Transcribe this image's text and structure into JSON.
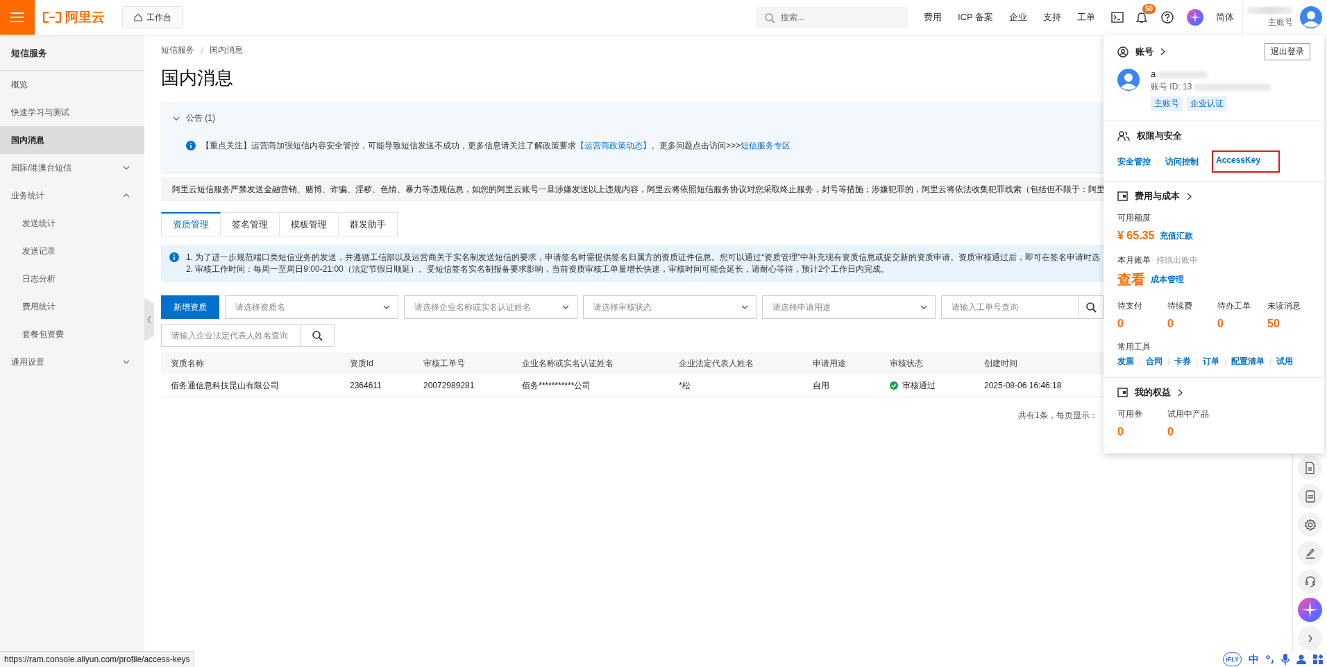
{
  "topbar": {
    "logo": "阿里云",
    "workbench": "工作台",
    "search_placeholder": "搜索...",
    "nav": [
      "费用",
      "ICP 备案",
      "企业",
      "支持",
      "工单"
    ],
    "notification_count": "50",
    "language": "简体",
    "account_role": "主账号"
  },
  "sidebar": {
    "title": "短信服务",
    "items": [
      {
        "kind": "link",
        "label": "概览",
        "selected": false
      },
      {
        "kind": "link",
        "label": "快速学习与测试",
        "selected": false
      },
      {
        "kind": "link",
        "label": "国内消息",
        "selected": true
      },
      {
        "kind": "group",
        "label": "国际/港澳台短信",
        "selected": false,
        "expanded": false
      },
      {
        "kind": "group",
        "label": "业务统计",
        "selected": false,
        "expanded": true,
        "children": [
          {
            "label": "发送统计",
            "selected": false
          },
          {
            "label": "发送记录",
            "selected": false
          },
          {
            "label": "日志分析",
            "selected": false
          },
          {
            "label": "费用统计",
            "selected": false
          },
          {
            "label": "套餐包资费",
            "selected": false
          }
        ]
      },
      {
        "kind": "group",
        "label": "通用设置",
        "selected": false,
        "expanded": false
      }
    ]
  },
  "breadcrumb": [
    "短信服务",
    "国内消息"
  ],
  "page_title": "国内消息",
  "announcement": {
    "title": "公告 (1)",
    "expanded": true,
    "parts": [
      {
        "text": "【重点关注】运营商加强短信内容安全管控，可能导致短信发送不成功，更多信息请关注了解政策要求",
        "link": false
      },
      {
        "text": "【运营商政策动态】",
        "link": true
      },
      {
        "text": "。更多问题点击访问>>>",
        "link": false
      },
      {
        "text": "短信服务专区",
        "link": true
      }
    ]
  },
  "warning": "阿里云短信服务严禁发送金融营销、赌博、诈骗、淫秽、色情、暴力等违规信息，如您的阿里云账号一旦涉嫌发送以上违规内容，阿里云将依照短信服务协议对您采取终止服务，封号等措施；涉嫌犯罪的，阿里云将依法收集犯罪线索（包括但不限于：阿里",
  "tabs": [
    {
      "label": "资质管理",
      "selected": true
    },
    {
      "label": "签名管理",
      "selected": false
    },
    {
      "label": "模板管理",
      "selected": false
    },
    {
      "label": "群发助手",
      "selected": false
    }
  ],
  "notice": [
    "1. 为了进一步规范端口类短信业务的发送，并遵循工信部以及运营商关于实名制发送短信的要求，申请签名时需提供签名归属方的资质证件信息。您可以通过“资质管理”中补充现有资质信息或提交新的资质申请。资质审核通过后，即可在签名申请时选",
    "2. 审核工作时间：每周一至周日9:00-21:00（法定节假日顺延）。受短信签名实名制报备要求影响，当前资质审核工单量增长快速，审核时间可能会延长，请耐心等待，预计2个工作日内完成。"
  ],
  "filters": {
    "add_button": "新增资质",
    "selects": [
      "请选择资质名",
      "请选择企业名称或实名认证姓名",
      "请选择审核状态",
      "请选择申请用途"
    ],
    "inputs": [
      "请输入工单号查询",
      "请输入企业法定代表人姓名查询"
    ]
  },
  "table": {
    "columns": [
      "资质名称",
      "资质Id",
      "审核工单号",
      "企业名称或实名认证姓名",
      "企业法定代表人姓名",
      "申请用途",
      "审核状态",
      "创建时间"
    ],
    "rows": [
      {
        "cells": [
          "佰务通信息科技昆山有限公司",
          "2364611",
          "20072989281",
          "佰务***********公司",
          "*松",
          "自用",
          "审核通过",
          "2025-08-06 16:46:18"
        ],
        "kind": "approved"
      }
    ]
  },
  "pagination": "共有1条，每页显示：",
  "account_panel": {
    "title": "账号",
    "logout": "退出登录",
    "user_name": "a",
    "user_id": "账号 ID: 13",
    "tags": [
      "主账号",
      "企业认证"
    ],
    "security": {
      "title": "权限与安全",
      "links": [
        {
          "label": "安全管控",
          "highlighted": false
        },
        {
          "label": "访问控制",
          "highlighted": false
        },
        {
          "label": "AccessKey",
          "highlighted": true
        }
      ]
    },
    "billing": {
      "title": "费用与成本",
      "credit_label": "可用额度",
      "credit": "¥ 65.35",
      "recharge": "充值汇款",
      "bill_label": "本月账单",
      "bill_status": "持续出账中",
      "view": "查看",
      "cost": "成本管理",
      "stats": [
        {
          "label": "待支付",
          "value": "0"
        },
        {
          "label": "待续费",
          "value": "0"
        },
        {
          "label": "待办工单",
          "value": "0"
        },
        {
          "label": "未读消息",
          "value": "50"
        }
      ],
      "tools_label": "常用工具",
      "tools": [
        "发票",
        "合同",
        "卡券",
        "订单",
        "配置清单",
        "试用"
      ]
    },
    "benefits": {
      "title": "我的权益",
      "stats": [
        {
          "label": "可用券",
          "value": "0"
        },
        {
          "label": "试用中产品",
          "value": "0"
        }
      ]
    }
  },
  "status_url": "https://ram.console.aliyun.com/profile/access-keys",
  "ime": {
    "logo": "iFLY",
    "mode": "中"
  }
}
